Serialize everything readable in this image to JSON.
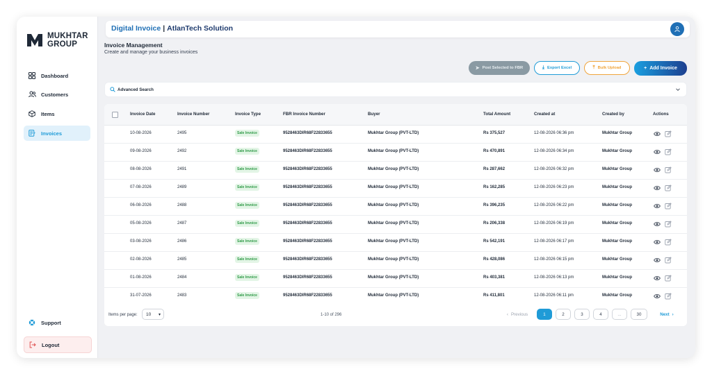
{
  "brand": {
    "line1": "MUKHTAR",
    "line2": "GROUP"
  },
  "sidebar": {
    "items": [
      {
        "label": "Dashboard",
        "icon": "grid-icon"
      },
      {
        "label": "Customers",
        "icon": "users-icon"
      },
      {
        "label": "Items",
        "icon": "box-icon"
      },
      {
        "label": "Invoices",
        "icon": "invoice-icon",
        "active": true
      }
    ],
    "support": "Support",
    "logout": "Logout"
  },
  "topbar": {
    "title_a": "Digital Invoice",
    "title_sep": "|",
    "title_b": "AtlanTech Solution",
    "avatar_icon": "user-icon"
  },
  "page": {
    "title": "Invoice Management",
    "subtitle": "Create and manage your business invoices"
  },
  "actions": {
    "post_fbr": "Post Selected to FBR",
    "export": "Export Excel",
    "bulk": "Bulk Upload",
    "add": "Add Invoice"
  },
  "search": {
    "label": "Advanced Search"
  },
  "table": {
    "headers": [
      "Invoice Date",
      "Invoice Number",
      "Invoice Type",
      "FBR Invoice Number",
      "Buyer",
      "Total Amount",
      "Created at",
      "Created by",
      "Actions"
    ],
    "rows": [
      [
        "10-08-2026",
        "2495",
        "Sale Invoice",
        "9528463DIR68F22833655",
        "Mukhtar Group (PVT-LTD)",
        "Rs 375,527",
        "12-08-2026 06:36 pm",
        "Mukhtar Group"
      ],
      [
        "09-08-2026",
        "2492",
        "Sale Invoice",
        "9528463DIR68F22833655",
        "Mukhtar Group (PVT-LTD)",
        "Rs 470,891",
        "12-08-2026 06:34 pm",
        "Mukhtar Group"
      ],
      [
        "08-08-2026",
        "2491",
        "Sale Invoice",
        "9528463DIR68F22833655",
        "Mukhtar Group (PVT-LTD)",
        "Rs 287,662",
        "12-08-2026 06:32 pm",
        "Mukhtar Group"
      ],
      [
        "07-08-2026",
        "2489",
        "Sale Invoice",
        "9528463DIR68F22833655",
        "Mukhtar Group (PVT-LTD)",
        "Rs 162,285",
        "12-08-2026 06:23 pm",
        "Mukhtar Group"
      ],
      [
        "06-08-2026",
        "2488",
        "Sale Invoice",
        "9528463DIR68F22833655",
        "Mukhtar Group (PVT-LTD)",
        "Rs 396,235",
        "12-08-2026 06:22 pm",
        "Mukhtar Group"
      ],
      [
        "05-08-2026",
        "2487",
        "Sale Invoice",
        "9528463DIR68F22833655",
        "Mukhtar Group (PVT-LTD)",
        "Rs 206,338",
        "12-08-2026 06:19 pm",
        "Mukhtar Group"
      ],
      [
        "03-08-2026",
        "2486",
        "Sale Invoice",
        "9528463DIR68F22833655",
        "Mukhtar Group (PVT-LTD)",
        "Rs 542,191",
        "12-08-2026 06:17 pm",
        "Mukhtar Group"
      ],
      [
        "02-08-2026",
        "2485",
        "Sale Invoice",
        "9528463DIR68F22833655",
        "Mukhtar Group (PVT-LTD)",
        "Rs 428,086",
        "12-08-2026 06:15 pm",
        "Mukhtar Group"
      ],
      [
        "01-08-2026",
        "2484",
        "Sale Invoice",
        "9528463DIR68F22833655",
        "Mukhtar Group (PVT-LTD)",
        "Rs 403,381",
        "12-08-2026 06:13 pm",
        "Mukhtar Group"
      ],
      [
        "31-07-2026",
        "2483",
        "Sale Invoice",
        "9528463DIR68F22833655",
        "Mukhtar Group (PVT-LTD)",
        "Rs 411,801",
        "12-08-2026 06:11 pm",
        "Mukhtar Group"
      ]
    ]
  },
  "pagination": {
    "items_per_page_label": "Items per page:",
    "items_per_page": "10",
    "range": "1-10 of 296",
    "previous": "Previous",
    "pages": [
      "1",
      "2",
      "3",
      "4",
      "...",
      "30"
    ],
    "current": "1",
    "next": "Next"
  },
  "colors": {
    "accent": "#1f9bd7",
    "brand_dark": "#1d3f8f",
    "badge_green": "#2f9a47"
  }
}
